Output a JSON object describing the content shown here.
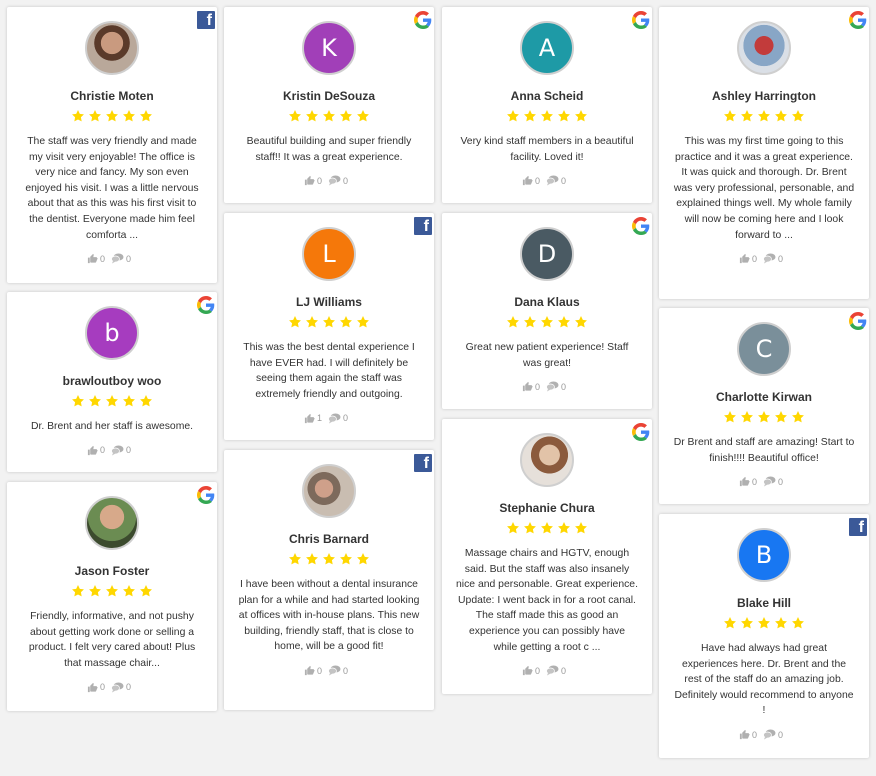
{
  "colors": {
    "star": "#ffd700",
    "facebook": "#3b5998"
  },
  "reviews": [
    {
      "name": "Christie Moten",
      "source": "facebook",
      "avatar_type": "photo",
      "text": "The staff was very friendly and made my visit very enjoyable! The office is very nice and fancy. My son even enjoyed his visit. I was a little nervous about that as this was his first visit to the dentist. Everyone made him feel comforta ...",
      "likes": "0",
      "comments": "0"
    },
    {
      "name": "brawloutboy woo",
      "source": "google",
      "avatar_type": "letter",
      "letter": "b",
      "avatar_color": "#a63cbf",
      "text": "Dr. Brent and her staff is awesome.",
      "likes": "0",
      "comments": "0"
    },
    {
      "name": "Jason Foster",
      "source": "google",
      "avatar_type": "photo",
      "text": "Friendly, informative, and not pushy about getting work done or selling a product. I felt very cared about! Plus that massage chair...",
      "likes": "0",
      "comments": "0"
    },
    {
      "name": "Kristin DeSouza",
      "source": "google",
      "avatar_type": "letter",
      "letter": "K",
      "avatar_color": "#a13fb8",
      "text": "Beautiful building and super friendly staff!! It was a great experience.",
      "likes": "0",
      "comments": "0"
    },
    {
      "name": "LJ Williams",
      "source": "facebook",
      "avatar_type": "letter",
      "letter": "L",
      "avatar_color": "#f5780a",
      "text": "This was the best dental experience I have EVER had. I will definitely be seeing them again the staff was extremely friendly and outgoing.",
      "likes": "1",
      "comments": "0"
    },
    {
      "name": "Chris Barnard",
      "source": "facebook",
      "avatar_type": "photo",
      "text": "I have been without a dental insurance plan for a while and had started looking at offices with in-house plans. This new building, friendly staff, that is close to home, will be a good fit!",
      "likes": "0",
      "comments": "0"
    },
    {
      "name": "Anna Scheid",
      "source": "google",
      "avatar_type": "letter",
      "letter": "A",
      "avatar_color": "#1e9aa6",
      "text": "Very kind staff members in a beautiful facility. Loved it!",
      "likes": "0",
      "comments": "0"
    },
    {
      "name": "Dana Klaus",
      "source": "google",
      "avatar_type": "letter",
      "letter": "D",
      "avatar_color": "#4a5a63",
      "text": "Great new patient experience! Staff was great!",
      "likes": "0",
      "comments": "0"
    },
    {
      "name": "Stephanie Chura",
      "source": "google",
      "avatar_type": "photo",
      "text": "Massage chairs and HGTV, enough said. But the staff was also insanely nice and personable. Great experience. Update: I went back in for a root canal. The staff made this as good an experience you can possibly have while getting a root c ...",
      "likes": "0",
      "comments": "0"
    },
    {
      "name": "Ashley Harrington",
      "source": "google",
      "avatar_type": "photo",
      "text": "This was my first time going to this practice and it was a great experience. It was quick and thorough. Dr. Brent was very professional, personable, and explained things well. My whole family will now be coming here and I look forward to ...",
      "likes": "0",
      "comments": "0"
    },
    {
      "name": "Charlotte Kirwan",
      "source": "google",
      "avatar_type": "letter",
      "letter": "C",
      "avatar_color": "#7a8f9a",
      "text": "Dr Brent and staff are amazing! Start to finish!!!! Beautiful office!",
      "likes": "0",
      "comments": "0"
    },
    {
      "name": "Blake Hill",
      "source": "facebook",
      "avatar_type": "letter",
      "letter": "B",
      "avatar_color": "#1877f2",
      "text": "Have had always had great experiences here. Dr. Brent and the rest of the staff do an amazing job. Definitely would recommend to anyone !",
      "likes": "0",
      "comments": "0"
    }
  ]
}
